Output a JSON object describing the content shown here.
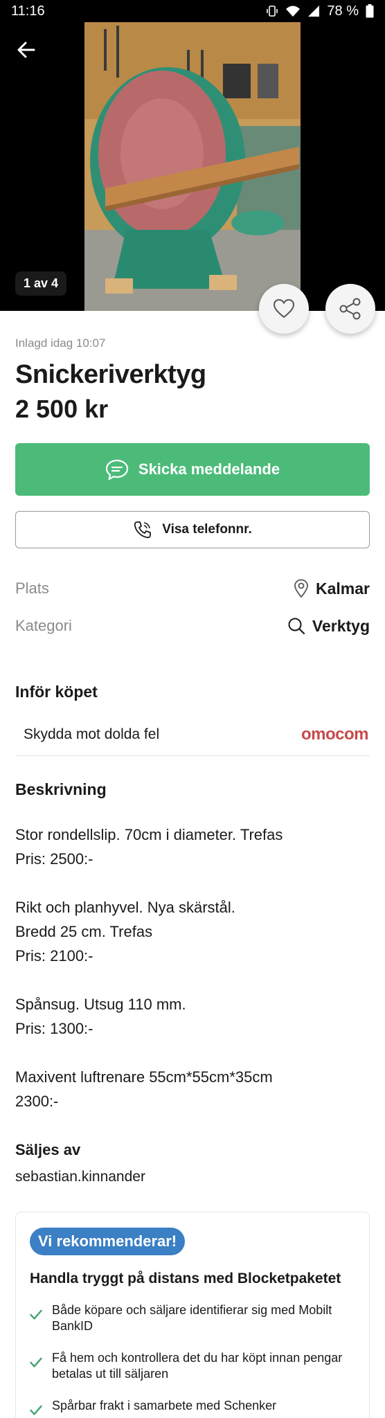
{
  "status_bar": {
    "time": "11:16",
    "battery": "78 %"
  },
  "gallery": {
    "counter": "1 av 4"
  },
  "listing": {
    "posted": "Inlagd idag 10:07",
    "title": "Snickeriverktyg",
    "price": "2 500 kr"
  },
  "actions": {
    "message_label": "Skicka meddelande",
    "phone_label": "Visa telefonnr."
  },
  "details": {
    "location_label": "Plats",
    "location_value": "Kalmar",
    "category_label": "Kategori",
    "category_value": "Verktyg"
  },
  "before_purchase": {
    "heading": "Inför köpet",
    "protect_text": "Skydda mot dolda fel",
    "partner_logo": "omocom"
  },
  "description": {
    "heading": "Beskrivning",
    "paragraphs": [
      [
        "Stor rondellslip. 70cm i diameter. Trefas",
        "Pris: 2500:-"
      ],
      [
        "Rikt och planhyvel. Nya skärstål.",
        "Bredd 25 cm. Trefas",
        "Pris: 2100:-"
      ],
      [
        "Spånsug. Utsug 110 mm.",
        "Pris: 1300:-"
      ],
      [
        "Maxivent luftrenare 55cm*55cm*35cm",
        "2300:-"
      ]
    ]
  },
  "seller": {
    "heading": "Säljes av",
    "name": "sebastian.kinnander"
  },
  "recommendation": {
    "badge": "Vi rekommenderar!",
    "title": "Handla tryggt på distans med Blocketpaketet",
    "items": [
      "Både köpare och säljare identifierar sig med Mobilt BankID",
      "Få hem och kontrollera det du har köpt innan pengar betalas ut till säljaren",
      "Spårbar frakt i samarbete med Schenker"
    ]
  },
  "colors": {
    "primary_green": "#4cbb7a",
    "badge_blue": "#3b7fc4",
    "partner_red": "#c74a4a"
  }
}
